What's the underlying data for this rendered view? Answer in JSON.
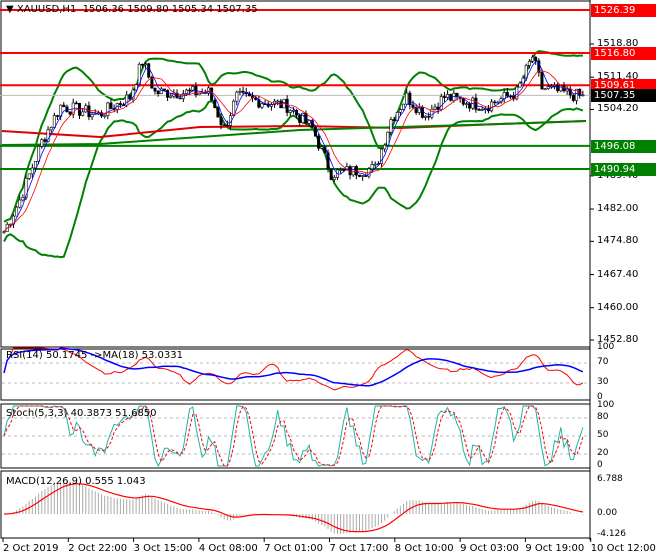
{
  "header": {
    "symbol": "XAUUSD,H1",
    "ohlc": "1506.36 1509.80 1505.34 1507.35"
  },
  "price_axis": [
    "1518.80",
    "1511.40",
    "1504.20",
    "1489.40",
    "1482.00",
    "1474.80",
    "1467.40",
    "1460.00",
    "1452.80"
  ],
  "levels": [
    {
      "value": "1526.39",
      "color": "#ff0000"
    },
    {
      "value": "1516.80",
      "color": "#ff0000"
    },
    {
      "value": "1509.61",
      "color": "#ff0000"
    },
    {
      "value": "1507.35",
      "color": "#000000"
    },
    {
      "value": "1496.08",
      "color": "#008000"
    },
    {
      "value": "1490.94",
      "color": "#008000"
    }
  ],
  "rsi": {
    "label": "RSI(14) 50.1745  ->MA(18) 53.0331",
    "axis": [
      "100",
      "70",
      "30",
      "0"
    ]
  },
  "stoch": {
    "label": "Stoch(5,3,3) 40.3873 51.6850",
    "axis": [
      "100",
      "80",
      "50",
      "20",
      "0"
    ]
  },
  "macd": {
    "label": "MACD(12,26,9) 0.555 1.043",
    "axis": [
      "6.788",
      "0.00",
      "-4.126"
    ]
  },
  "time_axis": [
    "2 Oct 2019",
    "2 Oct 22:00",
    "3 Oct 15:00",
    "4 Oct 08:00",
    "7 Oct 01:00",
    "7 Oct 17:00",
    "8 Oct 10:00",
    "9 Oct 03:00",
    "9 Oct 19:00",
    "10 Oct 12:00"
  ],
  "chart_data": {
    "type": "candlestick",
    "ylim": [
      1452.8,
      1526.39
    ],
    "close_keypoints": [
      [
        0,
        1477
      ],
      [
        5,
        1484
      ],
      [
        12,
        1497
      ],
      [
        18,
        1505
      ],
      [
        30,
        1503
      ],
      [
        40,
        1507
      ],
      [
        44,
        1515
      ],
      [
        48,
        1508
      ],
      [
        65,
        1508
      ],
      [
        70,
        1500
      ],
      [
        74,
        1507
      ],
      [
        90,
        1505
      ],
      [
        98,
        1500
      ],
      [
        104,
        1490
      ],
      [
        118,
        1491
      ],
      [
        123,
        1502
      ],
      [
        128,
        1507
      ],
      [
        134,
        1503
      ],
      [
        140,
        1507
      ],
      [
        153,
        1505
      ],
      [
        163,
        1508
      ],
      [
        168,
        1516
      ],
      [
        171,
        1509
      ],
      [
        184,
        1507
      ]
    ]
  }
}
